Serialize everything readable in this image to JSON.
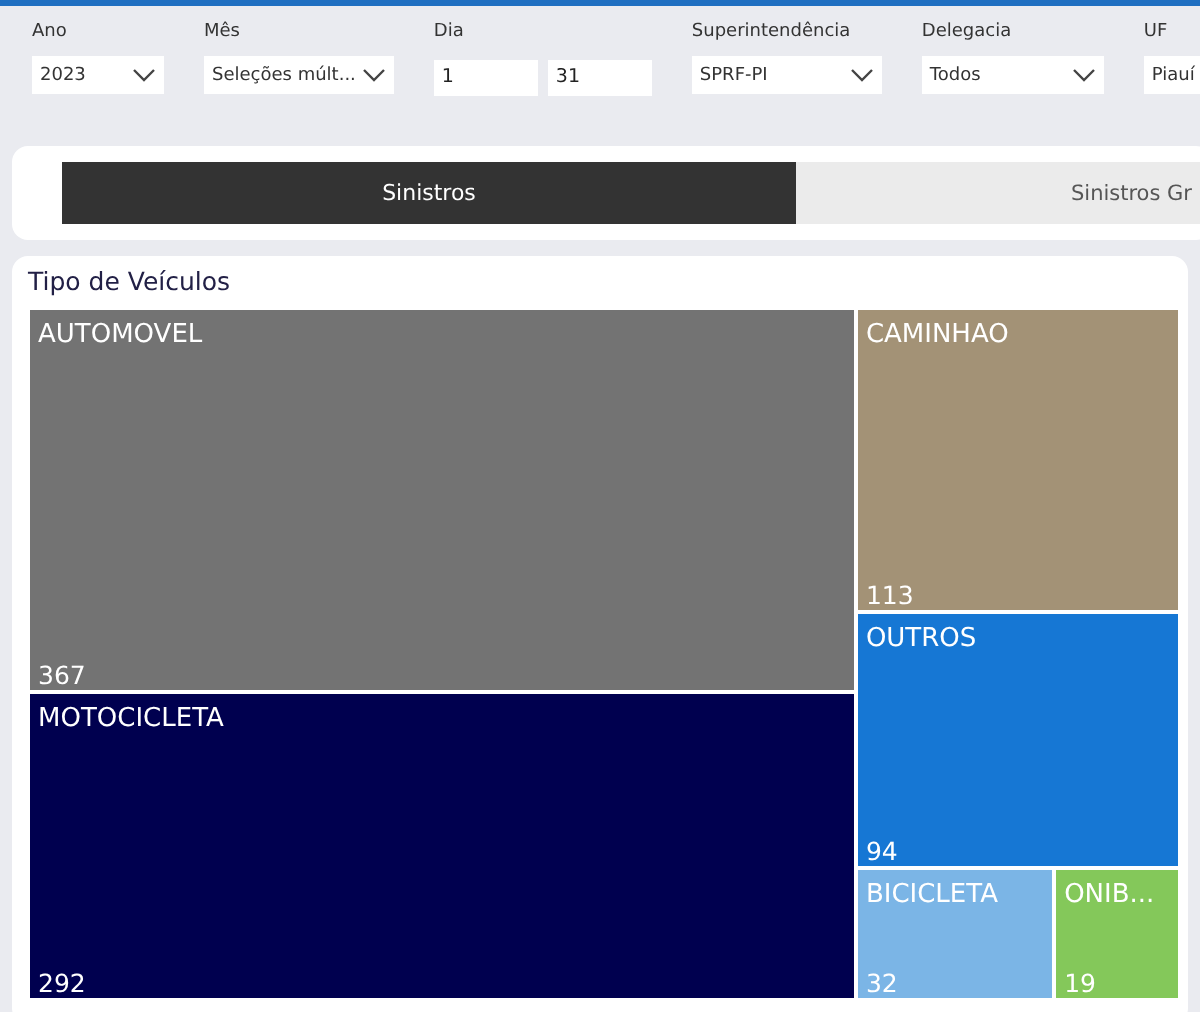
{
  "filters": [
    {
      "kind": "dropdown",
      "label": "Ano",
      "value": "2023"
    },
    {
      "kind": "dropdown",
      "label": "Mês",
      "value": "Seleções múlt..."
    },
    {
      "kind": "range",
      "label": "Dia",
      "from": "1",
      "to": "31"
    },
    {
      "kind": "dropdown",
      "label": "Superintendência",
      "value": "SPRF-PI"
    },
    {
      "kind": "dropdown",
      "label": "Delegacia",
      "value": "Todos"
    },
    {
      "kind": "open",
      "label": "UF",
      "value": "Piauí"
    }
  ],
  "tabs": [
    {
      "label": "Sinistros",
      "selected": true
    },
    {
      "label": "Sinistros Gr",
      "selected": false
    }
  ],
  "chart": {
    "title": "Tipo de Veículos",
    "tiles": [
      {
        "name": "AUTOMOVEL",
        "value": "367",
        "color": "#737373"
      },
      {
        "name": "MOTOCICLETA",
        "value": "292",
        "color": "#00004f"
      },
      {
        "name": "CAMINHAO",
        "value": "113",
        "color": "#a39276"
      },
      {
        "name": "OUTROS",
        "value": "94",
        "color": "#1677d4"
      },
      {
        "name": "BICICLETA",
        "value": "32",
        "color": "#7bb5e6"
      },
      {
        "name": "ONIB...",
        "value": "19",
        "color": "#84c85a"
      }
    ]
  }
}
